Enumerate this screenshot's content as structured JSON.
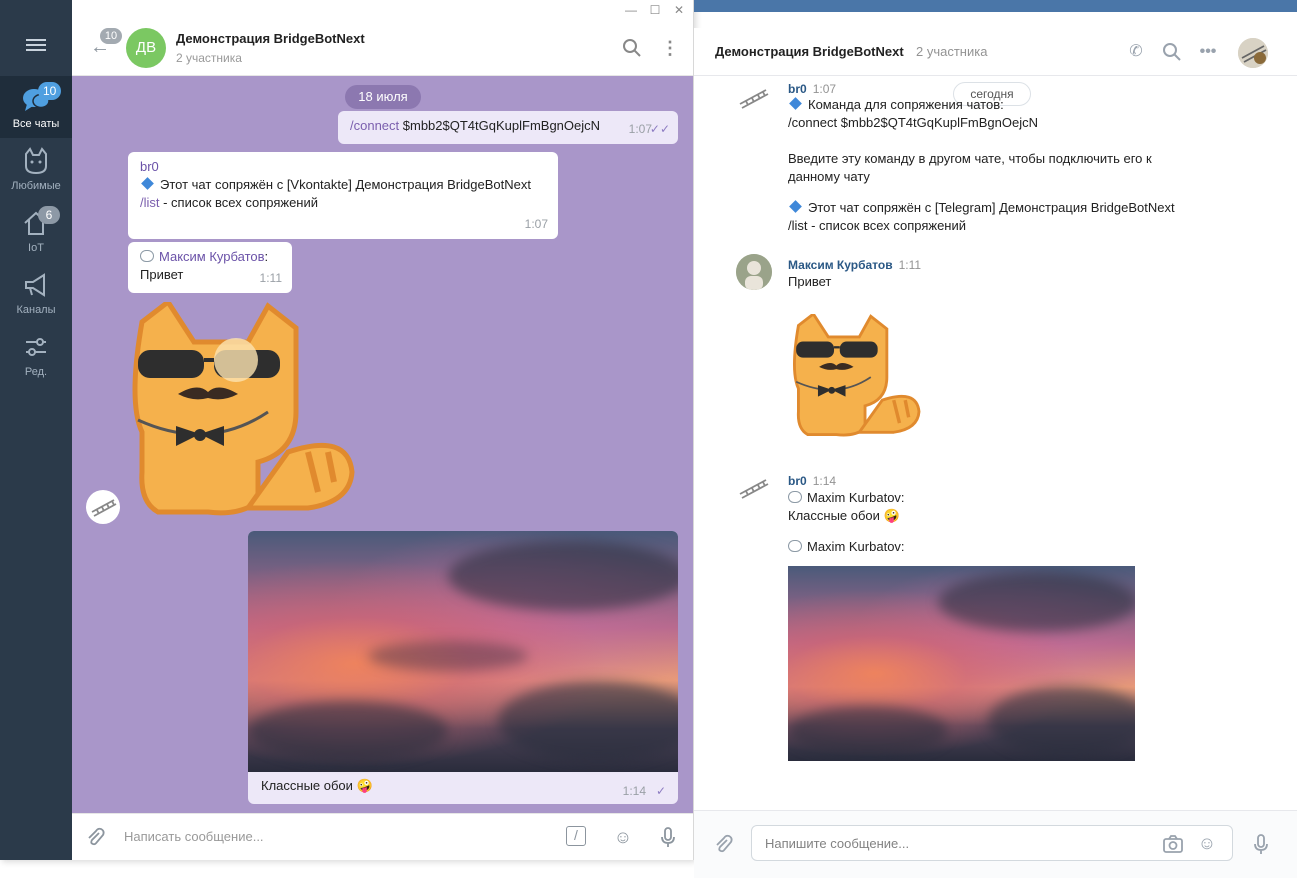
{
  "telegram": {
    "sidebar": {
      "folders": [
        {
          "label": "Все чаты",
          "badge": "10"
        },
        {
          "label": "Любимые",
          "badge": ""
        },
        {
          "label": "IoT",
          "badge": "6"
        },
        {
          "label": "Каналы",
          "badge": ""
        },
        {
          "label": "Ред.",
          "badge": ""
        }
      ]
    },
    "header": {
      "back_badge": "10",
      "avatar_initials": "ДВ",
      "title": "Демонстрация BridgeBotNext",
      "subtitle": "2 участника"
    },
    "chat": {
      "date": "18 июля",
      "msg_connect": {
        "command": "/connect",
        "args": " $mbb2$QT4tGqKuplFmBgnOejcN",
        "time": "1:07"
      },
      "msg_bot": {
        "sender": "br0",
        "line1": "Этот чат сопряжён с [Vkontakte] Демонстрация BridgeBotNext",
        "list_cmd": "/list",
        "list_rest": " - список всех сопряжений",
        "time": "1:07"
      },
      "msg_user": {
        "sender": "Максим Курбатов",
        "sender_suffix": ":",
        "text": "Привет",
        "time": "1:11"
      },
      "msg_photo": {
        "caption": "Классные обои 🤪",
        "time": "1:14"
      }
    },
    "input": {
      "placeholder": "Написать сообщение..."
    }
  },
  "vk": {
    "header": {
      "title": "Демонстрация BridgeBotNext",
      "subtitle": "2 участника"
    },
    "today": "сегодня",
    "messages": [
      {
        "sender": "br0",
        "time": "1:07",
        "lines": [
          "Команда для сопряжения чатов:",
          "/connect $mbb2$QT4tGqKuplFmBgnOejcN",
          "",
          "Введите эту команду в другом чате, чтобы подключить его к данному чату",
          "Этот чат сопряжён с [Telegram] Демонстрация BridgeBotNext",
          "/list - список всех сопряжений"
        ]
      },
      {
        "sender": "Максим Курбатов",
        "time": "1:11",
        "text": "Привет"
      },
      {
        "sender": "br0",
        "time": "1:14",
        "line1": "Maxim Kurbatov:",
        "line2": "Классные обои 🤪",
        "line3": "Maxim Kurbatov:"
      }
    ],
    "input": {
      "placeholder": "Напишите сообщение..."
    }
  }
}
